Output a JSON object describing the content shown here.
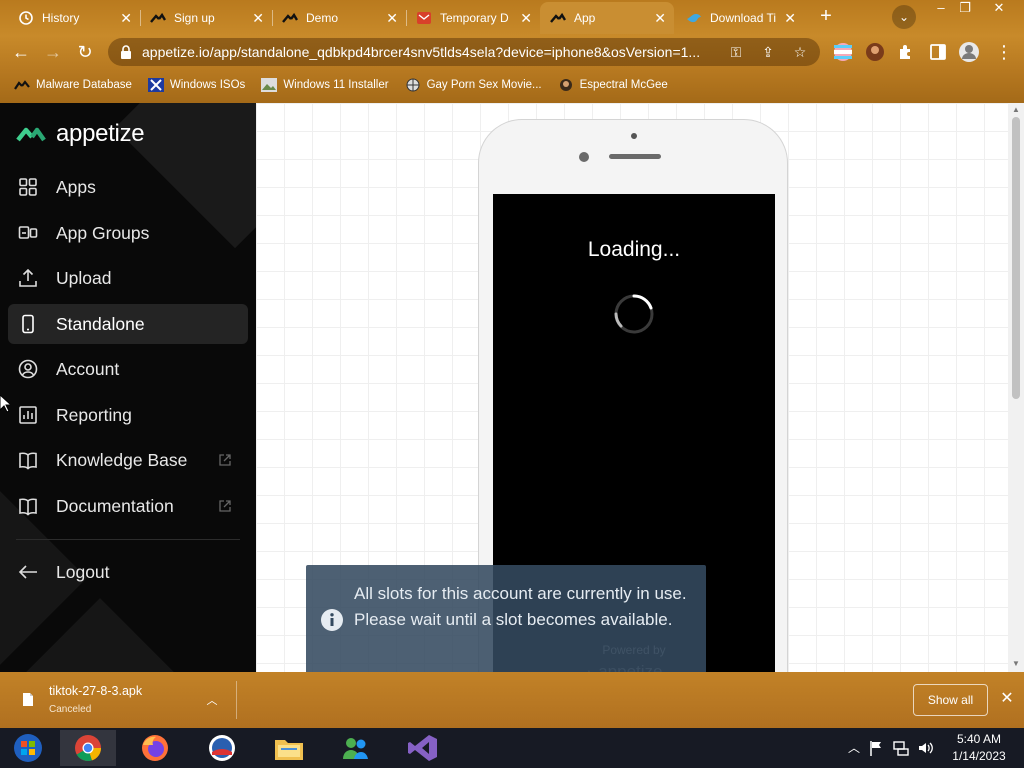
{
  "browser": {
    "tabs": [
      {
        "label": "History",
        "icon": "history-icon"
      },
      {
        "label": "Sign up",
        "icon": "appetize-logo-icon"
      },
      {
        "label": "Demo",
        "icon": "appetize-logo-icon"
      },
      {
        "label": "Temporary D",
        "icon": "temp-mail-icon"
      },
      {
        "label": "App",
        "icon": "appetize-logo-icon",
        "active": true
      },
      {
        "label": "Download Ti",
        "icon": "bird-icon"
      }
    ],
    "url": "appetize.io/app/standalone_qdbkpd4brcer4snv5tlds4sela?device=iphone8&osVersion=1...",
    "bookmarks": [
      {
        "label": "Malware Database"
      },
      {
        "label": "Windows ISOs"
      },
      {
        "label": "Windows 11 Installer"
      },
      {
        "label": "Gay Porn Sex Movie..."
      },
      {
        "label": "Espectral McGee"
      }
    ]
  },
  "sidebar": {
    "brand": "appetize",
    "items": [
      {
        "label": "Apps",
        "icon": "grid-icon"
      },
      {
        "label": "App Groups",
        "icon": "app-groups-icon"
      },
      {
        "label": "Upload",
        "icon": "upload-icon"
      },
      {
        "label": "Standalone",
        "icon": "phone-icon",
        "active": true
      },
      {
        "label": "Account",
        "icon": "account-icon"
      },
      {
        "label": "Reporting",
        "icon": "reporting-icon"
      },
      {
        "label": "Knowledge Base",
        "icon": "book-icon",
        "external": true
      },
      {
        "label": "Documentation",
        "icon": "book-icon",
        "external": true
      }
    ],
    "logout": "Logout"
  },
  "device": {
    "loading": "Loading...",
    "powered_by": "Powered by",
    "powered_brand": "appetize"
  },
  "toast": {
    "message": "All slots for this account are currently in use. Please wait until a slot becomes available."
  },
  "download": {
    "filename": "tiktok-27-8-3.apk",
    "status": "Canceled",
    "show_all": "Show all"
  },
  "taskbar": {
    "time": "5:40 AM",
    "date": "1/14/2023"
  },
  "colors": {
    "chrome_theme": "#b97a1e",
    "sidebar_bg": "#090909",
    "appetize_green": "#3ecf8e",
    "toast_bg": "#344a60"
  }
}
